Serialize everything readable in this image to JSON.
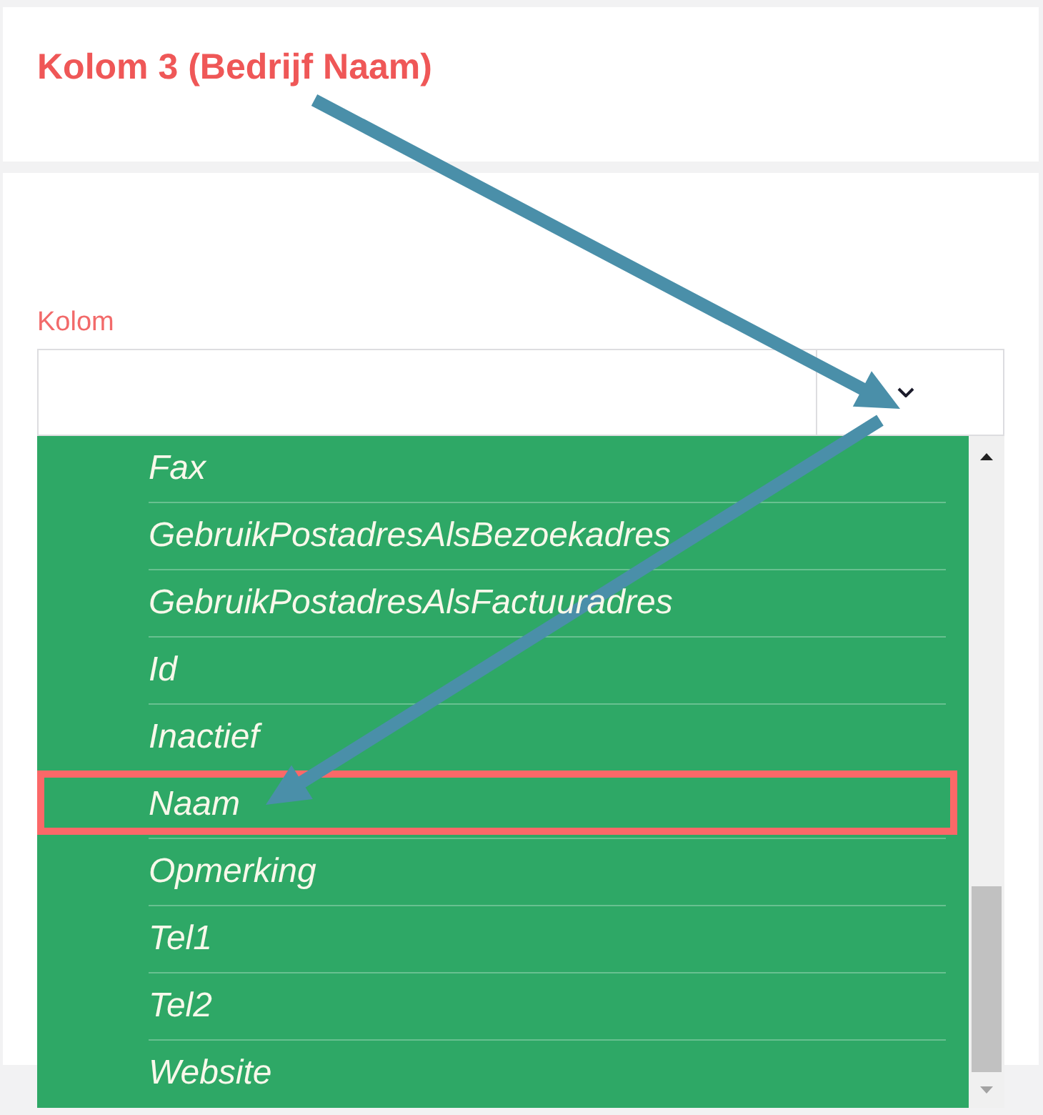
{
  "title": "Kolom 3 (Bedrijf Naam)",
  "column_field": {
    "label": "Kolom",
    "expanded": true,
    "options": [
      {
        "label": "Fax",
        "selected": false,
        "highlighted": false
      },
      {
        "label": "GebruikPostadresAlsBezoekadres",
        "selected": false,
        "highlighted": false
      },
      {
        "label": "GebruikPostadresAlsFactuuradres",
        "selected": false,
        "highlighted": false
      },
      {
        "label": "Id",
        "selected": false,
        "highlighted": false
      },
      {
        "label": "Inactief",
        "selected": false,
        "highlighted": false
      },
      {
        "label": "Naam",
        "selected": false,
        "highlighted": true
      },
      {
        "label": "Opmerking",
        "selected": false,
        "highlighted": false
      },
      {
        "label": "Tel1",
        "selected": false,
        "highlighted": false
      },
      {
        "label": "Tel2",
        "selected": false,
        "highlighted": false
      },
      {
        "label": "Website",
        "selected": false,
        "highlighted": false
      }
    ]
  }
}
